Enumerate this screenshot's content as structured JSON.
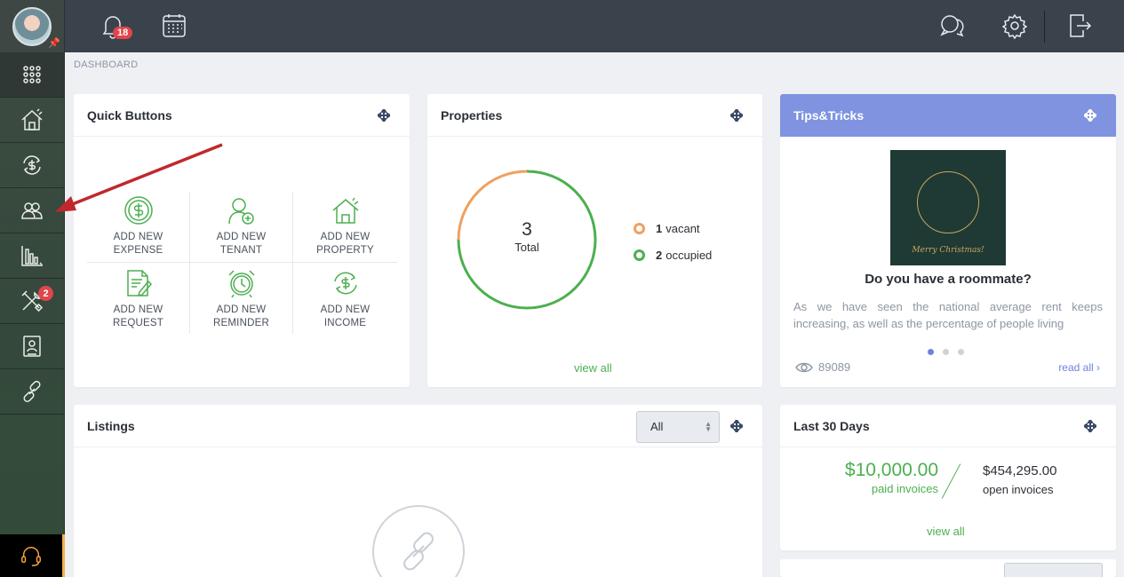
{
  "topbar": {
    "notifications_count": "18"
  },
  "breadcrumb": "DASHBOARD",
  "sidebar": {
    "tools_badge": "2"
  },
  "quick_buttons": {
    "title": "Quick Buttons",
    "items": [
      {
        "line1": "ADD NEW",
        "line2": "EXPENSE",
        "icon": "dollar-circle-icon"
      },
      {
        "line1": "ADD NEW",
        "line2": "TENANT",
        "icon": "add-user-icon"
      },
      {
        "line1": "ADD NEW",
        "line2": "PROPERTY",
        "icon": "house-icon"
      },
      {
        "line1": "ADD NEW",
        "line2": "REQUEST",
        "icon": "document-edit-icon"
      },
      {
        "line1": "ADD NEW",
        "line2": "REMINDER",
        "icon": "alarm-clock-icon"
      },
      {
        "line1": "ADD NEW",
        "line2": "INCOME",
        "icon": "dollar-refresh-icon"
      }
    ]
  },
  "properties": {
    "title": "Properties",
    "total": "3",
    "total_label": "Total",
    "vacant_count": "1",
    "vacant_label": "vacant",
    "occupied_count": "2",
    "occupied_label": "occupied",
    "vacant_fraction": 0.25,
    "vacant_color": "#f0a060",
    "occupied_color": "#4caf50",
    "view_all": "view all"
  },
  "tips": {
    "title": "Tips&Tricks",
    "image_caption": "Merry Christmas!",
    "headline": "Do you have a roommate?",
    "text": "As we have seen the national average rent keeps increasing, as well as the percentage of people living",
    "views": "89089",
    "read_all": "read all ›"
  },
  "listings": {
    "title": "Listings",
    "filter_value": "All"
  },
  "last30": {
    "title": "Last 30 Days",
    "paid_amount": "$10,000.00",
    "paid_label": "paid invoices",
    "open_amount": "$454,295.00",
    "open_label": "open invoices",
    "view_all": "view all"
  },
  "colors": {
    "accent_green": "#4caf50",
    "accent_blue": "#7f93e0",
    "topbar": "#3a424b"
  }
}
